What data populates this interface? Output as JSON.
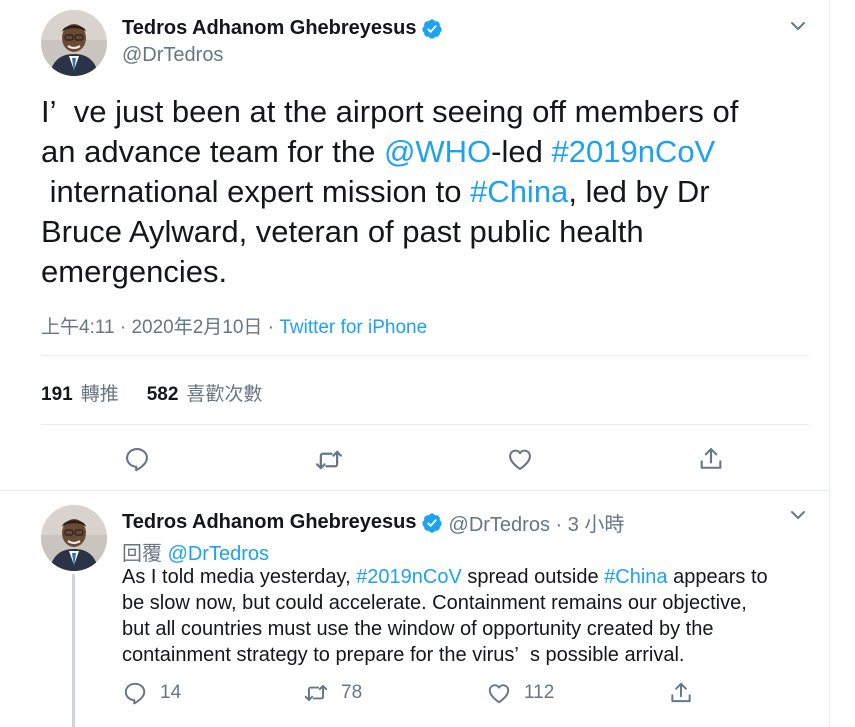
{
  "main_tweet": {
    "author_name": "Tedros Adhanom Ghebreyesus",
    "handle": "@DrTedros",
    "text_segments": [
      [
        "I’  ve just been at the airport seeing off members of"
      ],
      [
        "an advance team for the ",
        "@WHO",
        "-led ",
        "#2019nCoV"
      ],
      [
        " international expert mission to ",
        "#China",
        ", led by Dr"
      ],
      [
        "Bruce Aylward, veteran of past public health"
      ],
      [
        "emergencies."
      ]
    ],
    "line1": "I’  ve just been at the airport seeing off members of",
    "line2_a": "an advance team for the ",
    "line2_link1": "@WHO",
    "line2_b": "-led ",
    "line2_link2": "#2019nCoV",
    "line3_a": " international expert mission to ",
    "line3_link": "#China",
    "line3_b": ", led by Dr",
    "line4": "Bruce Aylward, veteran of past public health",
    "line5": "emergencies.",
    "timestamp": "上午4:11 · 2020年2月10日 · ",
    "source": "Twitter for iPhone",
    "retweet_count": "191",
    "retweet_label": "轉推",
    "like_count": "582",
    "like_label": "喜歡次數"
  },
  "reply_tweet": {
    "author_name": "Tedros Adhanom Ghebreyesus",
    "handle_time": "@DrTedros · 3 小時",
    "reply_prefix": "回覆 ",
    "reply_to": "@DrTedros",
    "line1_a": "As I told media yesterday, ",
    "line1_link1": "#2019nCoV",
    "line1_b": " spread outside ",
    "line1_link2": "#China",
    "line1_c": " appears to",
    "line2": "be slow now, but could accelerate. Containment remains our objective,",
    "line3": "but all countries must use the window of opportunity created by the",
    "line4": "containment strategy to prepare for the virus’  s possible arrival.",
    "reply_count": "14",
    "retweet_count": "78",
    "like_count": "112"
  },
  "colors": {
    "link": "#1da1f2",
    "secondary_text": "#657786",
    "verified": "#1da1f2",
    "divider": "#e6ecf0"
  },
  "icons": [
    "verified-badge-icon",
    "chevron-down-icon",
    "reply-icon",
    "retweet-icon",
    "like-icon",
    "share-icon"
  ]
}
